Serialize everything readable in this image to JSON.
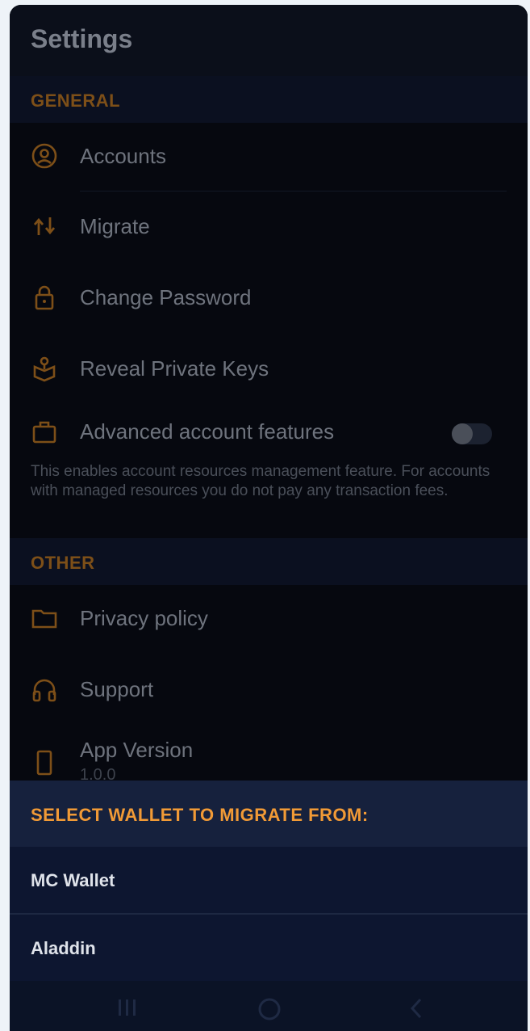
{
  "header": {
    "title": "Settings"
  },
  "sections": {
    "general": "GENERAL",
    "other": "OTHER"
  },
  "items": {
    "accounts": "Accounts",
    "migrate": "Migrate",
    "change_password": "Change Password",
    "reveal_keys": "Reveal Private Keys",
    "advanced": "Advanced account features",
    "advanced_desc": "This enables account resources management feature. For accounts with managed resources you do not pay any transaction fees.",
    "privacy": "Privacy policy",
    "support": "Support",
    "app_version": "App Version",
    "app_version_value": "1.0.0"
  },
  "advanced_toggle": {
    "on": false
  },
  "sheet": {
    "title": "SELECT WALLET TO MIGRATE FROM:",
    "options": [
      "MC Wallet",
      "Aladdin"
    ]
  },
  "colors": {
    "accent": "#f19a36",
    "dim_accent": "#7d4f18",
    "background": "#06080f",
    "sheet": "#0d1630"
  },
  "icons": {
    "accounts": "user-circle-icon",
    "migrate": "migrate-arrows-icon",
    "change_password": "lock-icon",
    "reveal_keys": "key-box-icon",
    "advanced": "briefcase-icon",
    "privacy": "folder-icon",
    "support": "headphones-icon",
    "app_version": "phone-icon",
    "nav_recent": "recent-apps-icon",
    "nav_home": "home-circle-icon",
    "nav_back": "back-chevron-icon"
  }
}
